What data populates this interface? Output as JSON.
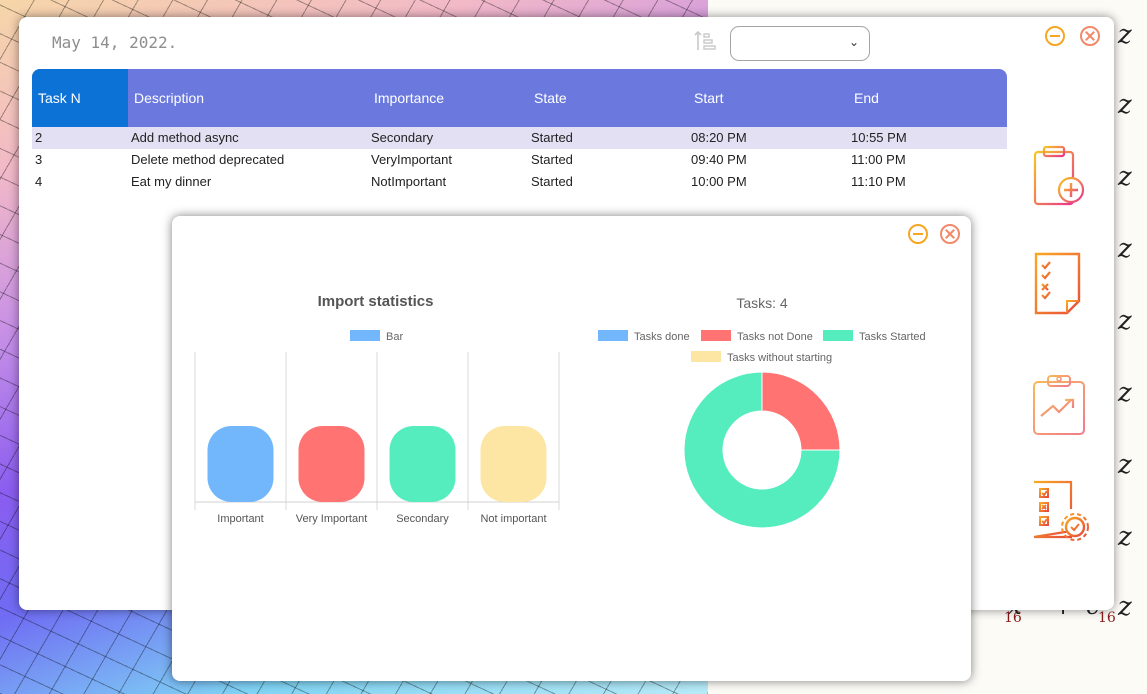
{
  "main_window": {
    "date": "May 14, 2022.",
    "filter_value": "",
    "table": {
      "headers": [
        "Task N",
        "Description",
        "Importance",
        "State",
        "Start",
        "End"
      ],
      "rows": [
        [
          "2",
          "Add method async",
          "Secondary",
          "Started",
          "08:20 PM",
          "10:55 PM"
        ],
        [
          "3",
          "Delete method deprecated",
          "VeryImportant",
          "Started",
          "09:40 PM",
          "11:00 PM"
        ],
        [
          "4",
          "Eat my dinner",
          "NotImportant",
          "Started",
          "10:00 PM",
          "11:10 PM"
        ]
      ]
    }
  },
  "side_icons": [
    "clipboard-add-icon",
    "checklist-icon",
    "clipboard-chart-icon",
    "task-settings-icon"
  ],
  "stats_window": {
    "bar_title": "Import statistics",
    "donut_title": "Tasks: 4"
  },
  "math_doc": {
    "repeated_symbol": "z",
    "bottom_fragments": [
      "x",
      "+",
      "c",
      "16",
      "16"
    ]
  },
  "colors": {
    "header_bg": "#6b79de",
    "header_active": "#0d72d6",
    "row_selected": "#e4e0f3",
    "blue": "#72b6fb",
    "red": "#ff7373",
    "teal": "#55ecbe",
    "yellow": "#fde6a3"
  },
  "chart_data": [
    {
      "type": "bar",
      "title": "Import statistics",
      "legend": [
        "Bar"
      ],
      "categories": [
        "Important",
        "Very Important",
        "Secondary",
        "Not important"
      ],
      "values": [
        1,
        1,
        1,
        1
      ],
      "colors": [
        "#72b6fb",
        "#ff7373",
        "#55ecbe",
        "#fde6a3"
      ]
    },
    {
      "type": "pie",
      "title": "Tasks: 4",
      "labels": [
        "Tasks done",
        "Tasks not Done",
        "Tasks Started",
        "Tasks without starting"
      ],
      "values": [
        0,
        1,
        3,
        0
      ],
      "colors": [
        "#72b6fb",
        "#ff7373",
        "#55ecbe",
        "#fde6a3"
      ],
      "legend_position": "top"
    }
  ]
}
